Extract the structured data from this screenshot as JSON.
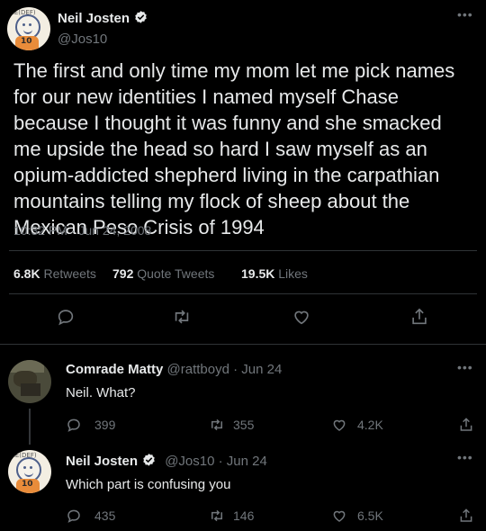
{
  "main": {
    "author": {
      "name": "Neil Josten",
      "handle": "@Jos10",
      "avatar_text": "RE(DEF)",
      "avatar_number": "10"
    },
    "text": "The first and only time my mom let me pick names for our new identities I named myself Chase because I thought it was funny and she smacked me upside the head so hard I saw myself as an opium-addicted shepherd living in the carpathian mountains telling my flock of sheep about the Mexican Peso Crisis of 1994",
    "timestamp": "10:32 PM · Jun 24, 2008",
    "stats": {
      "retweets_count": "6.8K",
      "retweets_label": "Retweets",
      "quotes_count": "792",
      "quotes_label": "Quote Tweets",
      "likes_count": "19.5K",
      "likes_label": "Likes"
    }
  },
  "replies": [
    {
      "name": "Comrade Matty",
      "handle": "@rattboyd",
      "time": "· Jun 24",
      "text": "Neil. What?",
      "replies": "399",
      "retweets": "355",
      "likes": "4.2K"
    },
    {
      "name": "Neil Josten",
      "handle": "@Jos10",
      "time": "· Jun 24",
      "text": "Which part is confusing you",
      "replies": "435",
      "retweets": "146",
      "likes": "6.5K"
    }
  ],
  "icons": {
    "more": "ellipsis-icon",
    "reply": "comment-icon",
    "retweet": "retweet-icon",
    "like": "heart-icon",
    "share": "share-icon",
    "verified": "verified-badge-icon"
  },
  "colors": {
    "background": "#000000",
    "text": "#e7e9ea",
    "muted": "#71767b",
    "divider": "#2f3336",
    "verified": "#e7e9ea"
  }
}
